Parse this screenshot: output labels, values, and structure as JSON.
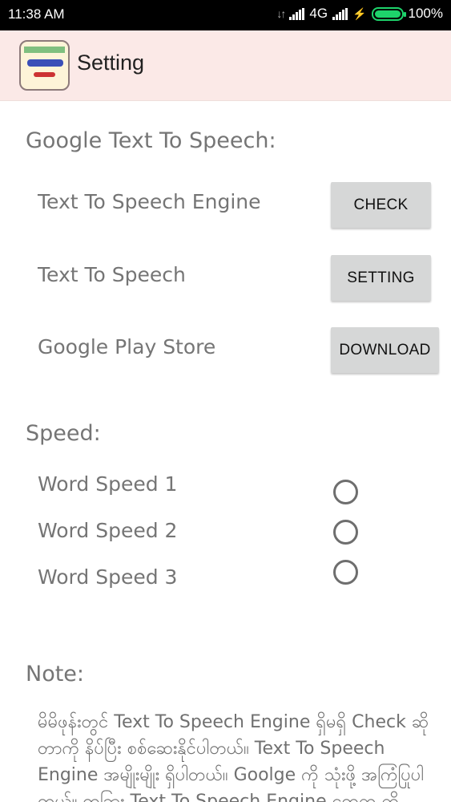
{
  "status_bar": {
    "time": "11:38 AM",
    "network": "4G",
    "battery": "100%",
    "battery_level": 1.0,
    "battery_color": "#1ed36b"
  },
  "app_bar": {
    "title": "Setting",
    "icon": "app-logo-icon",
    "background": "#fbe9e7"
  },
  "tts": {
    "title": "Google Text To Speech:",
    "rows": [
      {
        "label": "Text To Speech Engine",
        "button": "CHECK"
      },
      {
        "label": "Text To Speech",
        "button": "SETTING"
      },
      {
        "label": "Google Play Store",
        "button": "DOWNLOAD"
      }
    ]
  },
  "speed": {
    "title": "Speed:",
    "options": [
      {
        "label": "Word Speed 1",
        "selected": false
      },
      {
        "label": "Word Speed 2",
        "selected": false
      },
      {
        "label": "Word Speed 3",
        "selected": false
      }
    ]
  },
  "note": {
    "title": "Note:",
    "text": "မိမိဖုန်းတွင် Text To Speech Engine ရှိမရှိ Check ဆိုတာကို နိပ်ပြီး စစ်ဆေးနိုင်ပါတယ်။ Text To Speech Engine အမျိုးမျိုး ရှိပါတယ်။ Goolge ကို သုံးဖို့ အကြံပြုပါတယ်။ တခြား Text To Speech Engine တွေက ကို"
  }
}
